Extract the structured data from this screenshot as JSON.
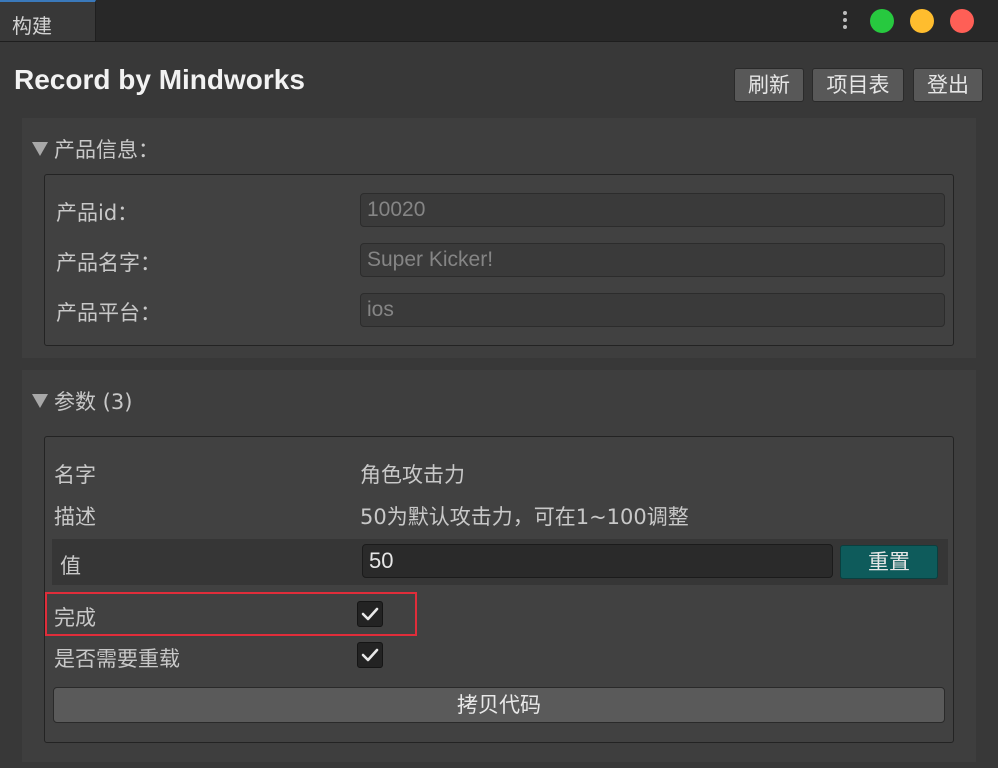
{
  "tab": {
    "label": "构建"
  },
  "window_controls": {
    "green": "#27c93f",
    "yellow": "#ffbd2e",
    "red": "#ff5f56",
    "menu_icon": "kebab-menu-icon"
  },
  "header": {
    "title": "Record by Mindworks",
    "buttons": {
      "refresh": "刷新",
      "projects": "项目表",
      "logout": "登出"
    }
  },
  "product_info": {
    "heading": "产品信息：",
    "fields": [
      {
        "label": "产品id：",
        "value": "10020"
      },
      {
        "label": "产品名字：",
        "value": "Super Kicker!"
      },
      {
        "label": "产品平台：",
        "value": "ios"
      }
    ]
  },
  "params": {
    "heading": "参数 (3)",
    "name_label": "名字",
    "name_value": "角色攻击力",
    "desc_label": "描述",
    "desc_value": "50为默认攻击力，可在1~100调整",
    "value_label": "值",
    "value": "50",
    "reset_label": "重置",
    "done_label": "完成",
    "done_checked": true,
    "reload_label": "是否需要重载",
    "reload_checked": true,
    "copy_label": "拷贝代码"
  },
  "colors": {
    "accent_tab": "#3a79bb",
    "reset_button": "#0e5b5b",
    "highlight_box": "#e02d3a"
  }
}
